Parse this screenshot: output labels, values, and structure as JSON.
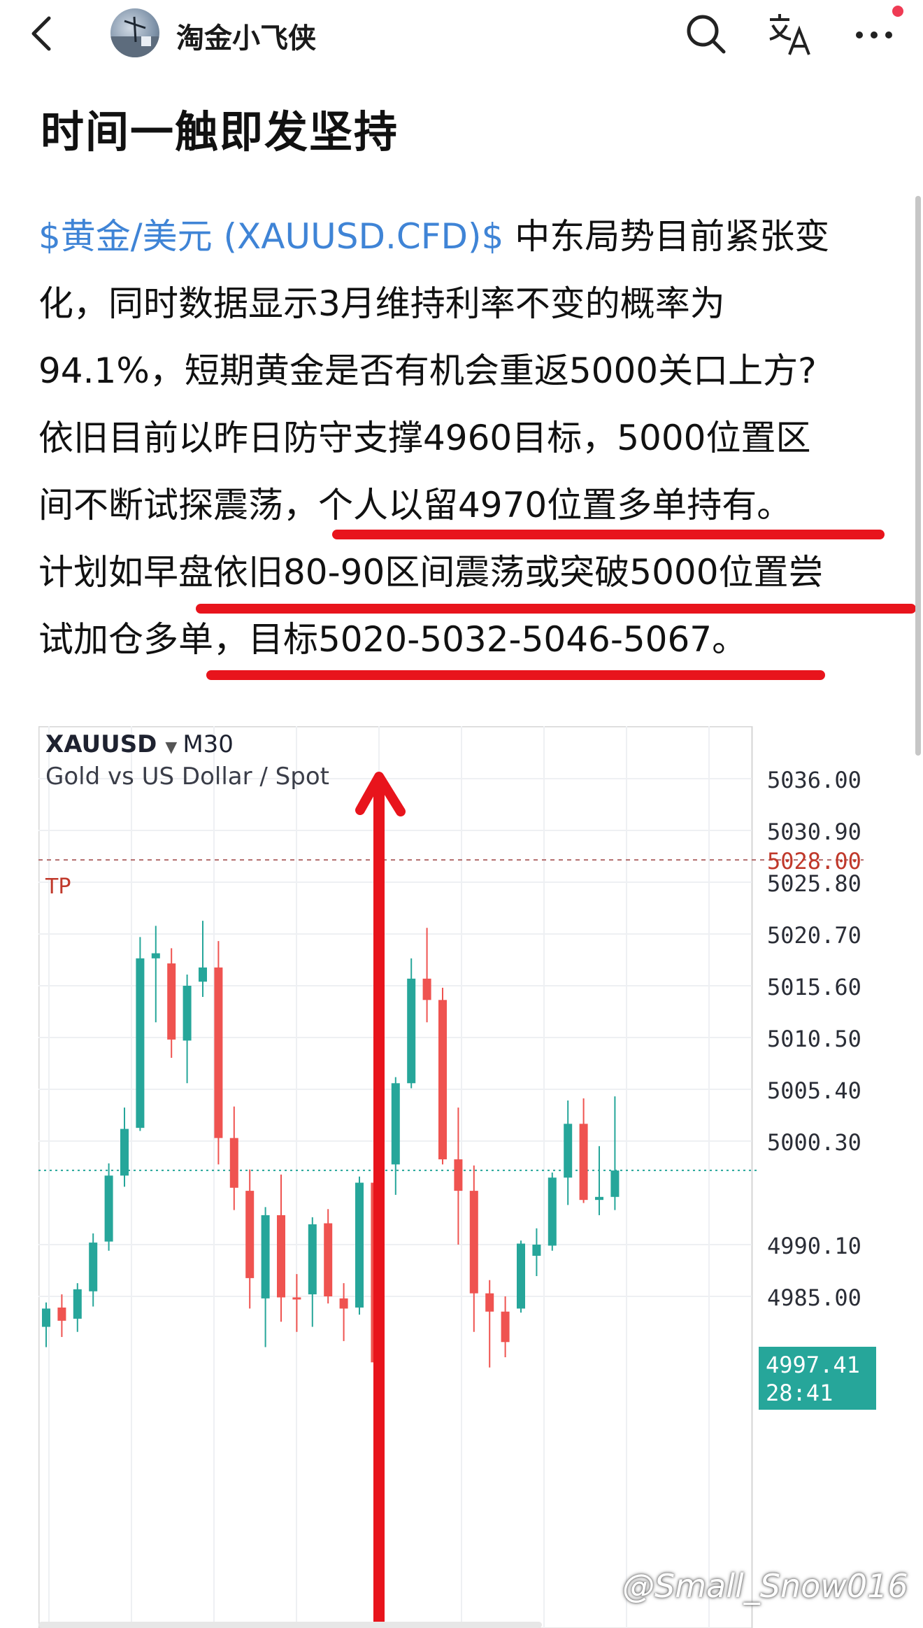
{
  "header": {
    "author_name": "淘金小飞侠",
    "back_icon": "chevron-left-icon",
    "search_icon": "search-icon",
    "translate_icon": "translate-icon",
    "more_icon": "more-dots-icon",
    "notification_dot_color": "#ef3b54"
  },
  "post": {
    "title": "时间一触即发坚持",
    "ticker": "$黄金/美元 (XAUUSD.CFD)$",
    "lines": [
      "中东局势目前紧张变",
      "化，同时数据显示3月维持利率不变的概率为",
      "94.1%，短期黄金是否有机会重返5000关口上方?",
      "依旧目前以昨日防守支撑4960目标，5000位置区",
      "间不断试探震荡，个人以留4970位置多单持有。",
      "计划如早盘依旧80-90区间震荡或突破5000位置尝",
      "试加仓多单，目标5020-5032-5046-5067。"
    ],
    "link_color": "#3f84d6",
    "underline_color": "#e8141c"
  },
  "chart": {
    "symbol": "XAUUSD",
    "timeframe": "M30",
    "subtitle": "Gold vs US Dollar / Spot",
    "tp_label": "TP",
    "tp_price": "5028.00",
    "current_price": "4997.41",
    "countdown": "28:41",
    "price_ticks": [
      "5036.00",
      "5030.90",
      "5025.80",
      "5020.70",
      "5015.60",
      "5010.50",
      "5005.40",
      "5000.30",
      "4990.10",
      "4985.00"
    ],
    "up_color": "#26a69a",
    "down_color": "#ef5350",
    "arrow_color": "#e8141c"
  },
  "chart_data": {
    "type": "candlestick",
    "y_ticks": [
      5036.0,
      5030.9,
      5025.8,
      5020.7,
      5015.6,
      5010.5,
      5005.4,
      5000.3,
      4990.1,
      4985.0
    ],
    "ylim": [
      4983.0,
      5038.0
    ],
    "tp_level": 5028.0,
    "current_price": 4997.41,
    "candles": [
      {
        "o": 4982.0,
        "h": 4984.4,
        "l": 4980.0,
        "c": 4983.8
      },
      {
        "o": 4983.9,
        "h": 4985.2,
        "l": 4981.0,
        "c": 4982.6
      },
      {
        "o": 4982.8,
        "h": 4986.3,
        "l": 4981.5,
        "c": 4985.7
      },
      {
        "o": 4985.5,
        "h": 4991.2,
        "l": 4984.0,
        "c": 4990.3
      },
      {
        "o": 4990.4,
        "h": 4998.1,
        "l": 4989.5,
        "c": 4996.9
      },
      {
        "o": 4996.9,
        "h": 5003.6,
        "l": 4995.8,
        "c": 5001.5
      },
      {
        "o": 5001.6,
        "h": 5020.4,
        "l": 5001.3,
        "c": 5018.3
      },
      {
        "o": 5018.3,
        "h": 5021.5,
        "l": 5012.0,
        "c": 5018.8
      },
      {
        "o": 5017.8,
        "h": 5019.3,
        "l": 5008.5,
        "c": 5010.3
      },
      {
        "o": 5010.2,
        "h": 5016.7,
        "l": 5006.0,
        "c": 5015.6
      },
      {
        "o": 5016.0,
        "h": 5022.0,
        "l": 5014.5,
        "c": 5017.4
      },
      {
        "o": 5017.4,
        "h": 5020.0,
        "l": 4998.0,
        "c": 5000.6
      },
      {
        "o": 5000.6,
        "h": 5003.7,
        "l": 4993.5,
        "c": 4995.7
      },
      {
        "o": 4995.4,
        "h": 4997.5,
        "l": 4983.8,
        "c": 4986.8
      },
      {
        "o": 4984.8,
        "h": 4993.8,
        "l": 4980.0,
        "c": 4993.0
      },
      {
        "o": 4993.0,
        "h": 4997.0,
        "l": 4982.5,
        "c": 4984.9
      },
      {
        "o": 4984.9,
        "h": 4987.2,
        "l": 4981.5,
        "c": 4984.7
      },
      {
        "o": 4985.2,
        "h": 4992.8,
        "l": 4982.0,
        "c": 4992.1
      },
      {
        "o": 4992.2,
        "h": 4993.6,
        "l": 4984.3,
        "c": 4985.0
      },
      {
        "o": 4984.8,
        "h": 4986.3,
        "l": 4980.6,
        "c": 4983.8
      },
      {
        "o": 4983.9,
        "h": 4996.8,
        "l": 4983.2,
        "c": 4996.2
      },
      {
        "o": 4996.2,
        "h": 4998.5,
        "l": 4976.0,
        "c": 4978.5
      },
      {
        "o": 4998.0,
        "h": 5006.6,
        "l": 4995.0,
        "c": 5006.0
      },
      {
        "o": 5006.0,
        "h": 5018.3,
        "l": 5005.5,
        "c": 5016.3
      },
      {
        "o": 5016.3,
        "h": 5021.3,
        "l": 5012.0,
        "c": 5014.2
      },
      {
        "o": 5014.2,
        "h": 5015.4,
        "l": 4998.0,
        "c": 4998.5
      },
      {
        "o": 4998.5,
        "h": 5003.6,
        "l": 4990.1,
        "c": 4995.4
      },
      {
        "o": 4995.4,
        "h": 4997.9,
        "l": 4981.5,
        "c": 4985.3
      },
      {
        "o": 4985.3,
        "h": 4986.6,
        "l": 4978.0,
        "c": 4983.5
      },
      {
        "o": 4983.5,
        "h": 4985.0,
        "l": 4979.0,
        "c": 4980.5
      },
      {
        "o": 4983.8,
        "h": 4990.5,
        "l": 4983.4,
        "c": 4990.2
      },
      {
        "o": 4989.0,
        "h": 4991.7,
        "l": 4987.0,
        "c": 4990.1
      },
      {
        "o": 4990.0,
        "h": 4997.2,
        "l": 4989.5,
        "c": 4996.7
      },
      {
        "o": 4996.7,
        "h": 5004.3,
        "l": 4994.0,
        "c": 5002.0
      },
      {
        "o": 5002.0,
        "h": 5004.5,
        "l": 4994.2,
        "c": 4994.5
      },
      {
        "o": 4994.5,
        "h": 4999.8,
        "l": 4993.0,
        "c": 4994.8
      },
      {
        "o": 4994.8,
        "h": 5004.7,
        "l": 4993.5,
        "c": 4997.4
      }
    ]
  }
}
